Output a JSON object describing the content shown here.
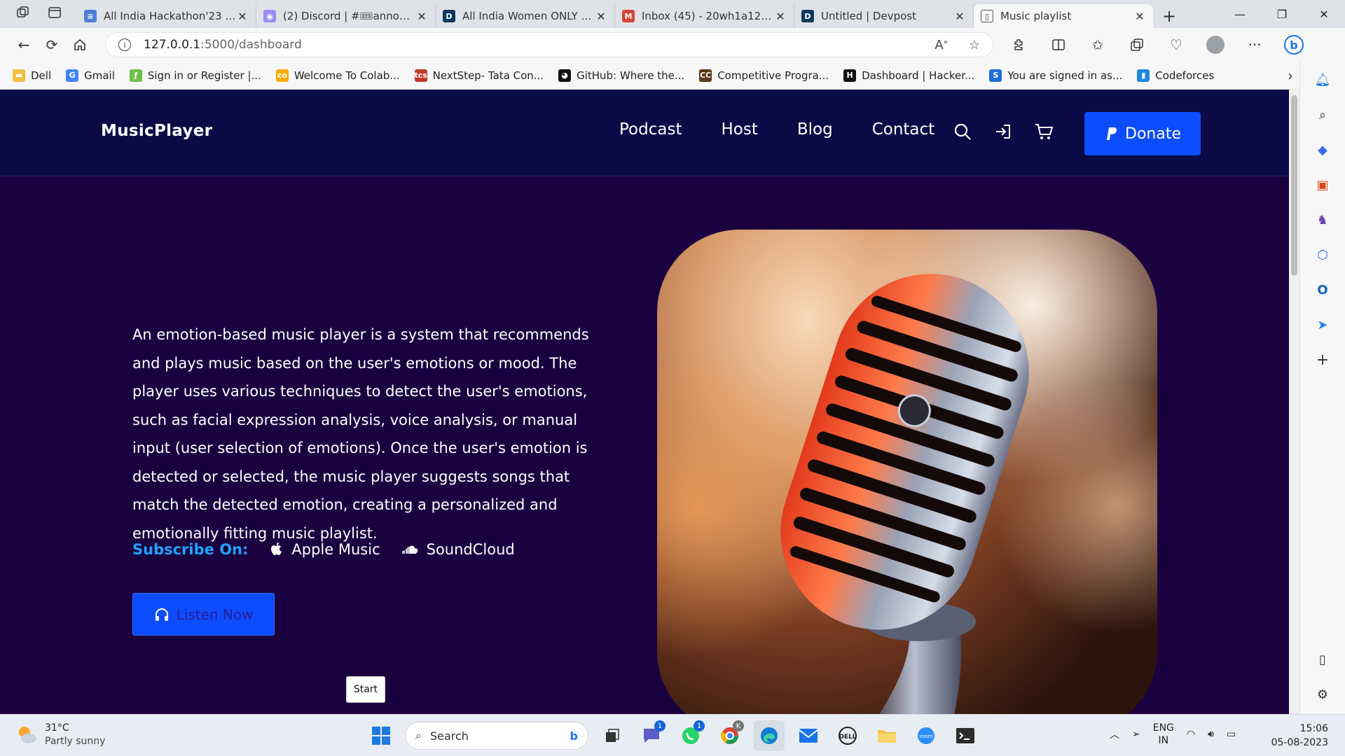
{
  "browser": {
    "tabs": [
      {
        "title": "All India Hackathon'23 Gui",
        "color": "#4e7fd6",
        "glyph": "≡",
        "active": false
      },
      {
        "title": "(2) Discord | #🎟announce",
        "color": "#9d8cf0",
        "glyph": "◉",
        "active": false
      },
      {
        "title": "All India Women ONLY Ha",
        "color": "#0a3a5c",
        "glyph": "D",
        "active": false
      },
      {
        "title": "Inbox (45) - 20wh1a1256@",
        "color": "#d44638",
        "glyph": "M",
        "active": false
      },
      {
        "title": "Untitled | Devpost",
        "color": "#0a3a5c",
        "glyph": "D",
        "active": false
      },
      {
        "title": "Music playlist",
        "color": "#ffffff",
        "glyph": "▯",
        "active": true
      }
    ],
    "address": {
      "host": "127.0.0.1",
      "path": ":5000/dashboard"
    },
    "bookmarks": [
      {
        "label": "Dell",
        "color": "#f0c040",
        "glyph": "▬"
      },
      {
        "label": "Gmail",
        "color": "#4285f4",
        "glyph": "G"
      },
      {
        "label": "Sign in or Register |...",
        "color": "#6cc04a",
        "glyph": "ƒ"
      },
      {
        "label": "Welcome To Colab...",
        "color": "#f9ab00",
        "glyph": "co"
      },
      {
        "label": "NextStep- Tata Con...",
        "color": "#c0392b",
        "glyph": "tcs"
      },
      {
        "label": "GitHub: Where the...",
        "color": "#111111",
        "glyph": "◕"
      },
      {
        "label": "Competitive Progra...",
        "color": "#5a3a1a",
        "glyph": "CC"
      },
      {
        "label": "Dashboard | Hacker...",
        "color": "#111111",
        "glyph": "H"
      },
      {
        "label": "You are signed in as...",
        "color": "#1e6fd9",
        "glyph": "S"
      },
      {
        "label": "Codeforces",
        "color": "#1e88e5",
        "glyph": "▮"
      }
    ]
  },
  "site": {
    "brand": "MusicPlayer",
    "nav": [
      "Podcast",
      "Host",
      "Blog",
      "Contact"
    ],
    "donate_label": "Donate",
    "description": "An emotion-based music player is a system that recommends and plays music based on the user's emotions or mood. The player uses various techniques to detect the user's emotions, such as facial expression analysis, voice analysis, or manual input (user selection of emotions). Once the user's emotion is detected or selected, the music player suggests songs that match the detected emotion, creating a personalized and emotionally fitting music playlist.",
    "subscribe_label": "Subscribe On:",
    "platforms": [
      "Apple Music",
      "SoundCloud"
    ],
    "listen_label": "Listen Now",
    "tooltip": "Start",
    "colors": {
      "navbar": "#0a0a46",
      "background": "#1b0040",
      "accent": "#0b4dff",
      "subscribe": "#1fa3ff"
    }
  },
  "taskbar": {
    "weather": {
      "temp": "31°C",
      "condition": "Partly sunny"
    },
    "search_placeholder": "Search",
    "lang": {
      "line1": "ENG",
      "line2": "IN"
    },
    "clock": {
      "time": "15:06",
      "date": "05-08-2023"
    },
    "badges": {
      "teams": "1",
      "whatsapp": "1",
      "chrome": "K"
    }
  }
}
